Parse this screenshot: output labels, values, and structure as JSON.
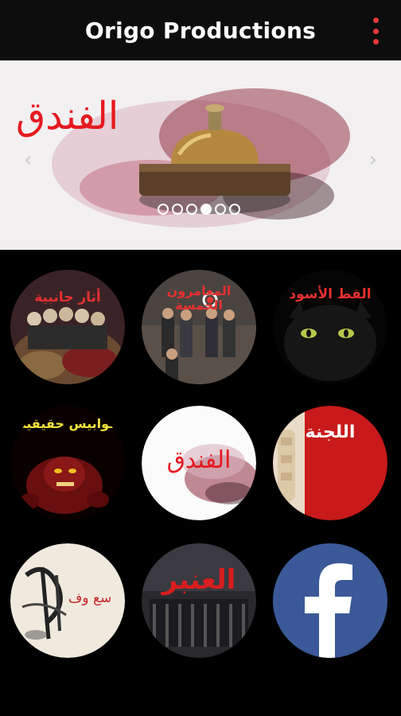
{
  "appbar": {
    "title": "Origo Productions",
    "menu_icon": "more-vert-icon"
  },
  "banner": {
    "title": "الفندق",
    "bell_label": "RECEPTION",
    "prev_icon": "chevron-left-icon",
    "next_icon": "chevron-right-icon",
    "page_count": 6,
    "active_index": 3
  },
  "tiles": [
    {
      "title": "أثار جانبية"
    },
    {
      "title": "المغامرون الخمسة"
    },
    {
      "title": "القط الأسود"
    },
    {
      "title": "كوابيس حقيقية"
    },
    {
      "title": "الفندق"
    },
    {
      "title": "اللجنة"
    },
    {
      "title": "سع وف"
    },
    {
      "title": "العنبر"
    },
    {
      "title": "facebook",
      "icon": "facebook-icon"
    }
  ],
  "colors": {
    "accent_red": "#e51a1f",
    "facebook_blue": "#3b5998",
    "background": "#000000"
  }
}
